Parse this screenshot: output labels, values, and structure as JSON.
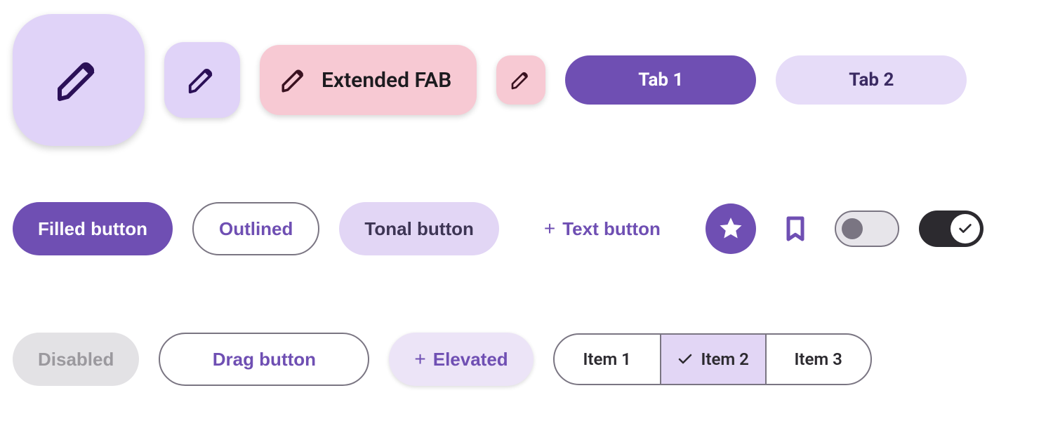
{
  "colors": {
    "primary": "#6F4FB3",
    "primaryContainer": "#E0D3F8",
    "secondaryContainer": "#F7C9D3",
    "tonal": "#E2D6F5",
    "outline": "#7a7582",
    "onSurface": "#1c1b1f",
    "switchOn": "#2c2a2f"
  },
  "fabs": {
    "extended_label": "Extended FAB",
    "icon": "edit-pencil"
  },
  "tabs": [
    {
      "label": "Tab 1",
      "selected": true
    },
    {
      "label": "Tab 2",
      "selected": false
    }
  ],
  "buttons": {
    "filled": "Filled button",
    "outlined": "Outlined",
    "tonal": "Tonal button",
    "text": "Text button",
    "disabled": "Disabled",
    "drag": "Drag button",
    "elevated": "Elevated"
  },
  "icon_buttons": {
    "star": "star-icon",
    "bookmark": "bookmark-icon"
  },
  "switches": [
    {
      "state": "off"
    },
    {
      "state": "on"
    }
  ],
  "segmented": [
    {
      "label": "Item 1",
      "selected": false
    },
    {
      "label": "Item 2",
      "selected": true
    },
    {
      "label": "Item 3",
      "selected": false
    }
  ]
}
